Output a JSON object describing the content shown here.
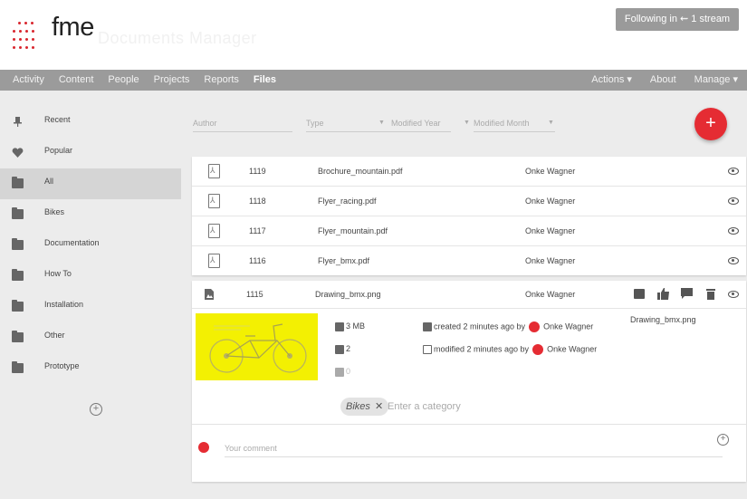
{
  "header": {
    "logo": "fme",
    "app_title": "Documents Manager",
    "follow_button": "Following in ⇜ 1 stream"
  },
  "nav": {
    "left": [
      "Activity",
      "Content",
      "People",
      "Projects",
      "Reports",
      "Files"
    ],
    "right": [
      "Actions ▾",
      "About",
      "Manage ▾"
    ]
  },
  "sidebar": {
    "items": [
      {
        "label": "Recent",
        "icon": "pin-icon"
      },
      {
        "label": "Popular",
        "icon": "heart-icon"
      },
      {
        "label": "All",
        "icon": "folder-icon"
      },
      {
        "label": "Bikes",
        "icon": "folder-icon"
      },
      {
        "label": "Documentation",
        "icon": "folder-icon"
      },
      {
        "label": "How To",
        "icon": "folder-icon"
      },
      {
        "label": "Installation",
        "icon": "folder-icon"
      },
      {
        "label": "Other",
        "icon": "folder-icon"
      },
      {
        "label": "Prototype",
        "icon": "folder-icon"
      }
    ],
    "add_symbol": "+"
  },
  "filters": {
    "author": "Author",
    "type": "Type",
    "modified_year": "Modified Year",
    "modified_month": "Modified Month"
  },
  "fab_symbol": "+",
  "files": [
    {
      "id": "1119",
      "name": "Brochure_mountain.pdf",
      "author": "Onke Wagner"
    },
    {
      "id": "1118",
      "name": "Flyer_racing.pdf",
      "author": "Onke Wagner"
    },
    {
      "id": "1117",
      "name": "Flyer_mountain.pdf",
      "author": "Onke Wagner"
    },
    {
      "id": "1116",
      "name": "Flyer_bmx.pdf",
      "author": "Onke Wagner"
    }
  ],
  "detail": {
    "id": "1115",
    "name": "Drawing_bmx.png",
    "author": "Onke Wagner",
    "preview_name": "Drawing_bmx.png",
    "size": "3 MB",
    "versions": "2",
    "comments_count": "0",
    "created": "created 2 minutes ago by",
    "modified": "modified 2 minutes ago by",
    "created_by": "Onke Wagner",
    "modified_by": "Onke Wagner",
    "category_chip": "Bikes",
    "category_placeholder": "Enter a category",
    "comment_placeholder": "Your comment",
    "add_symbol": "+"
  },
  "colors": {
    "accent": "#e52c33",
    "nav": "#9b9b9b",
    "thumbnail": "#f3f002"
  }
}
